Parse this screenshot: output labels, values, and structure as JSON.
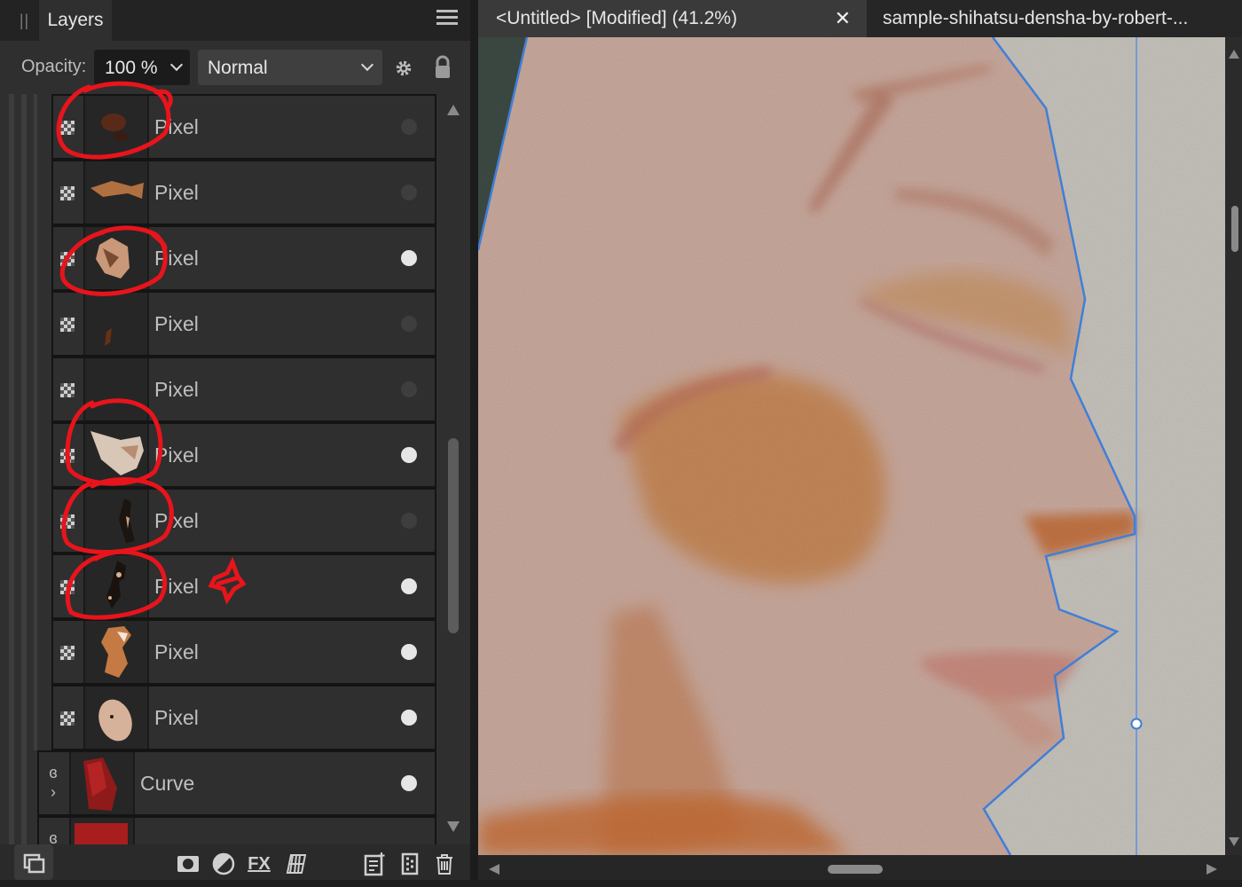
{
  "panel": {
    "tab_label": "Layers",
    "opacity_label": "Opacity:",
    "opacity_value": "100 %",
    "blend_mode": "Normal"
  },
  "layers": [
    {
      "name": "Pixel",
      "visible": false,
      "annotated": true
    },
    {
      "name": "Pixel",
      "visible": false,
      "annotated": false
    },
    {
      "name": "Pixel",
      "visible": true,
      "annotated": true
    },
    {
      "name": "Pixel",
      "visible": false,
      "annotated": false
    },
    {
      "name": "Pixel",
      "visible": false,
      "annotated": false
    },
    {
      "name": "Pixel",
      "visible": true,
      "annotated": true
    },
    {
      "name": "Pixel",
      "visible": false,
      "annotated": true
    },
    {
      "name": "Pixel",
      "visible": true,
      "annotated": true,
      "starred": true
    },
    {
      "name": "Pixel",
      "visible": true,
      "annotated": false
    },
    {
      "name": "Pixel",
      "visible": true,
      "annotated": false
    },
    {
      "name": "Curve",
      "visible": true,
      "annotated": false,
      "type": "curve"
    }
  ],
  "document": {
    "active_tab": "<Untitled> [Modified] (41.2%)",
    "inactive_tab": "sample-shihatsu-densha-by-robert-..."
  },
  "toolbar_icons": [
    "layers-studio-icon",
    "mask-icon",
    "adjustment-icon",
    "fx-icon",
    "live-filter-icon",
    "add-pixel-layer-icon",
    "add-group-icon",
    "delete-icon"
  ],
  "colors": {
    "panel_bg": "#2f2f2f",
    "annotation_red": "#e8141c",
    "selection_blue": "#3f7fd8"
  }
}
